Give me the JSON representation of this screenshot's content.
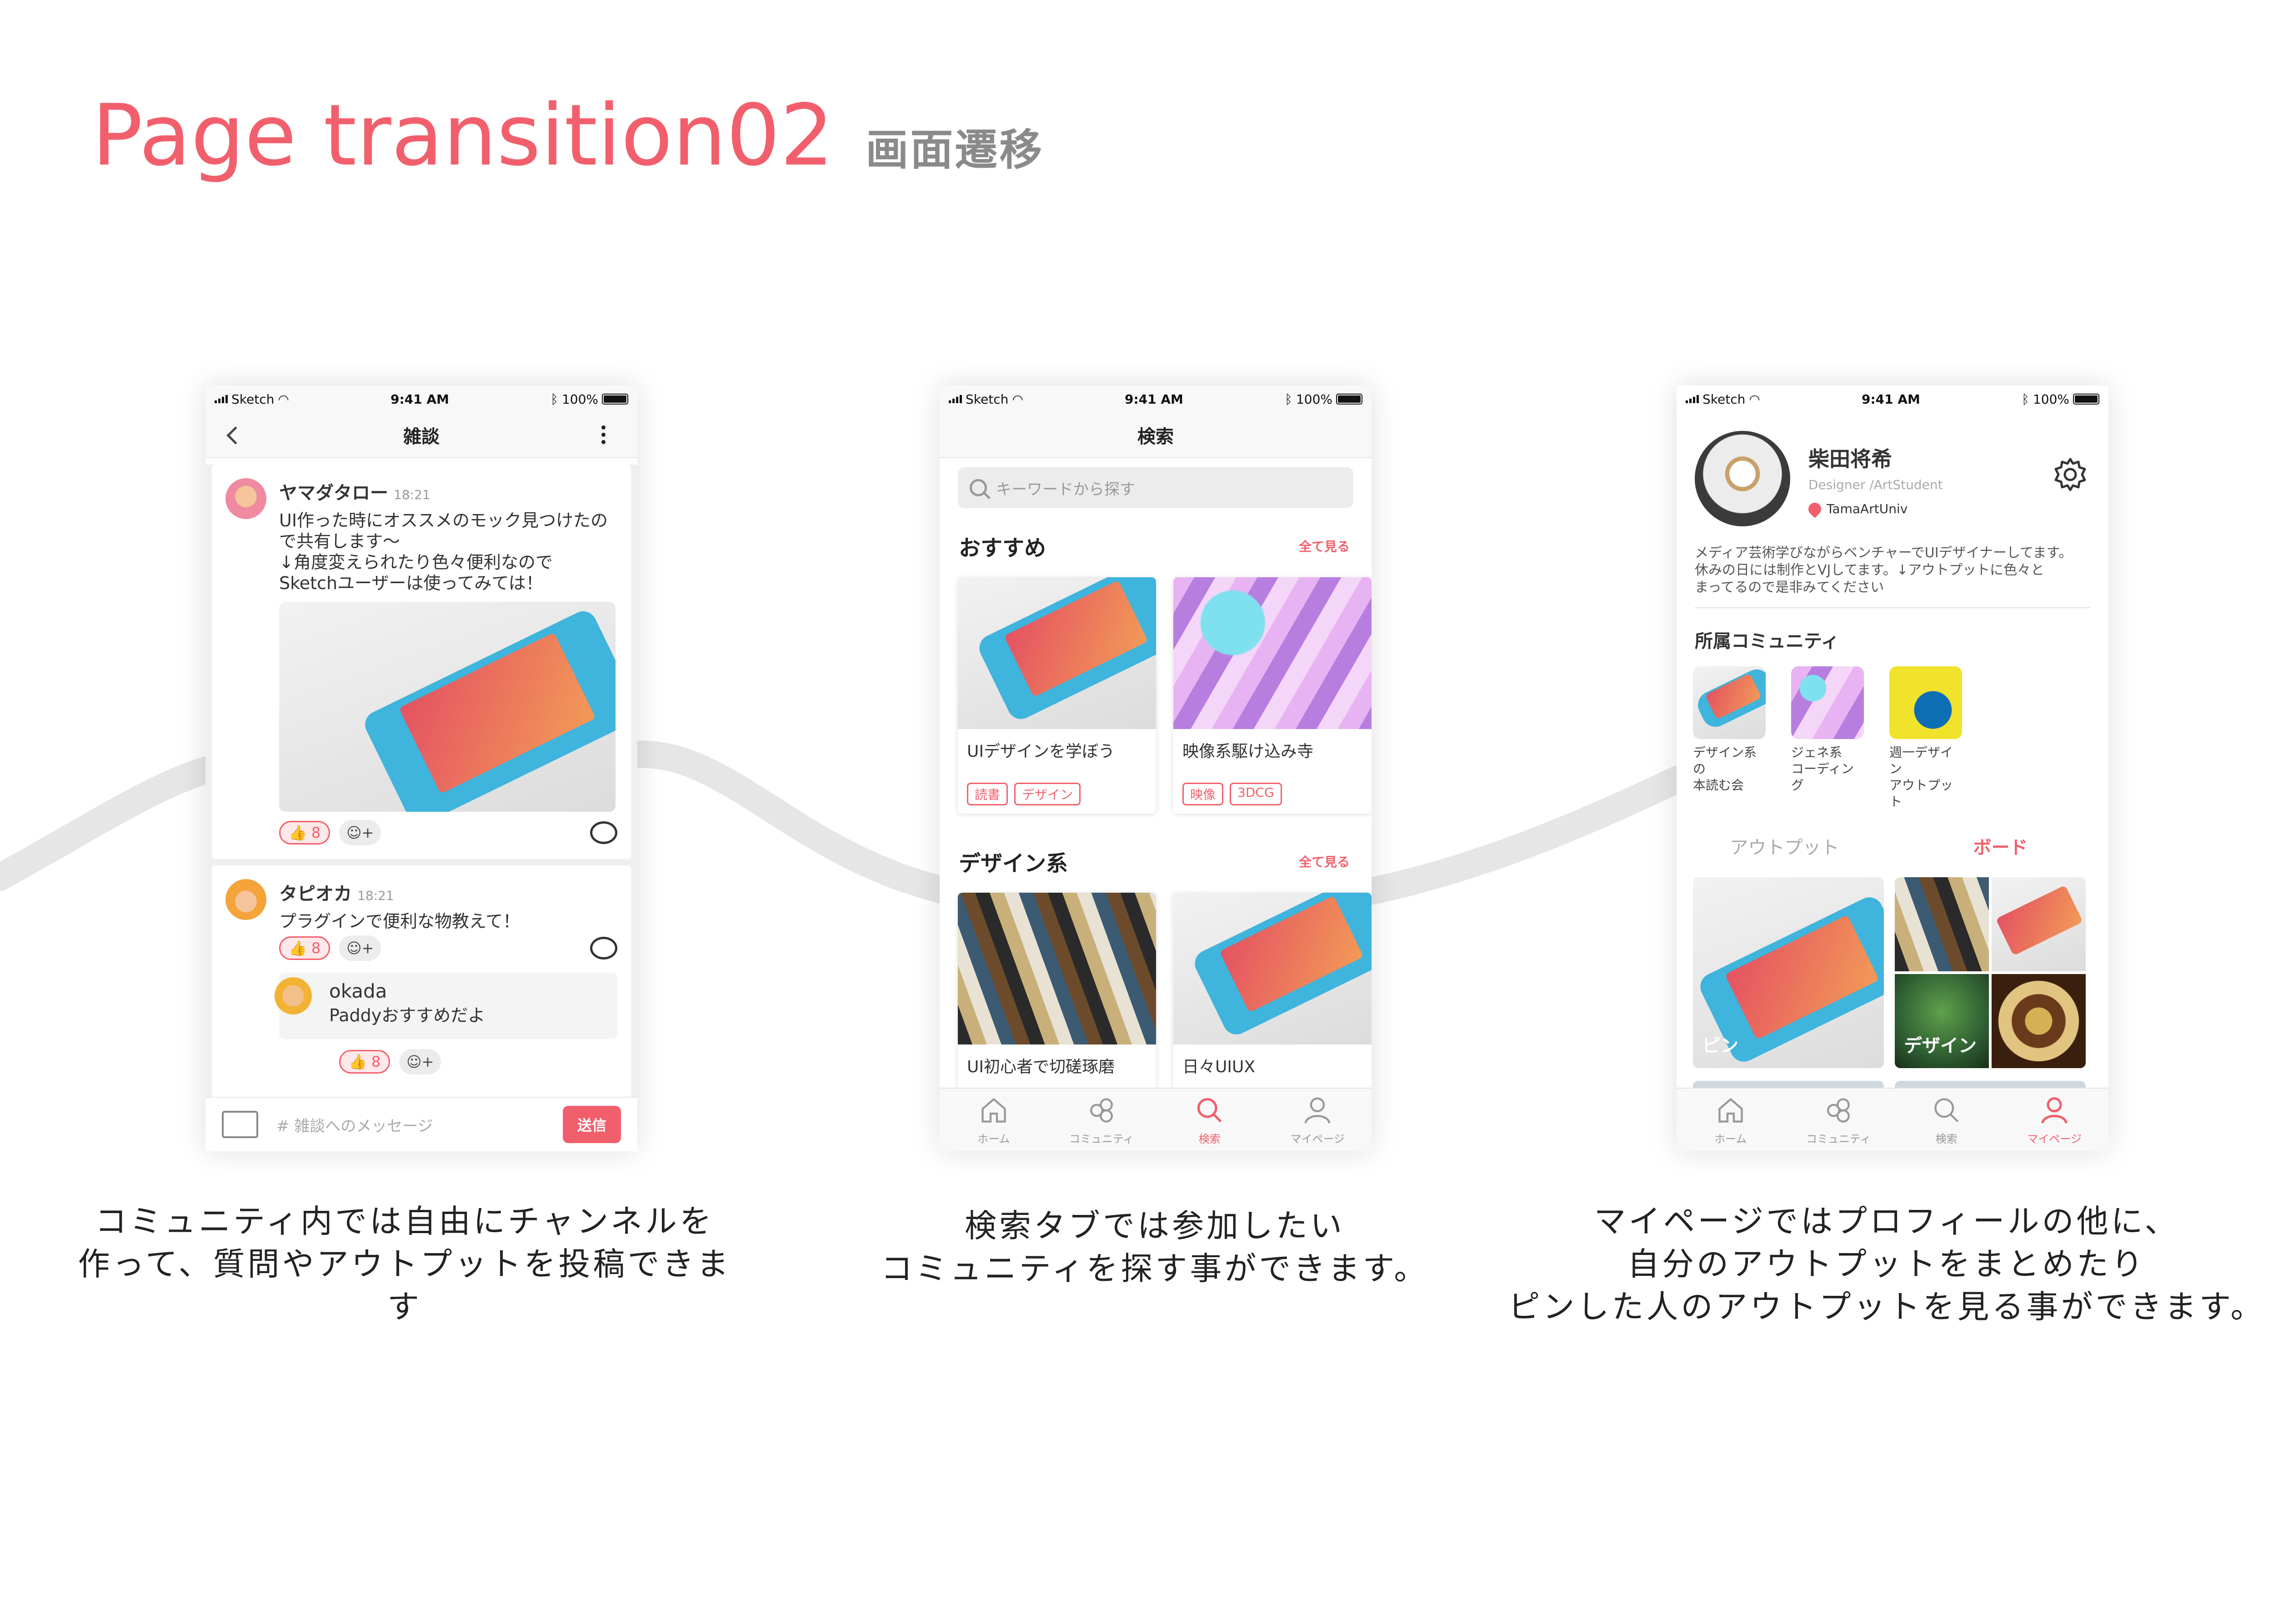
{
  "page": {
    "title_en": "Page transition02",
    "title_ja": "画面遷移"
  },
  "colors": {
    "accent": "#f25f6c",
    "text": "#333333",
    "muted": "#999999"
  },
  "status_bar": {
    "carrier": "Sketch",
    "time": "9:41 AM",
    "battery": "100%"
  },
  "chat_screen": {
    "nav_title": "雑談",
    "posts": [
      {
        "name": "ヤマダタロー",
        "time": "18:21",
        "text": "UI作った時にオススメのモック見つけたので共有します〜\n↓角度変えられたり色々便利なので\nSketchユーザーは使ってみては！",
        "likes": "8"
      },
      {
        "name": "タピオカ",
        "time": "18:21",
        "text": "プラグインで便利な物教えて！",
        "likes": "8",
        "reply": {
          "name": "okada",
          "text": "Paddyおすすめだよ",
          "likes": "8"
        }
      }
    ],
    "message_placeholder": "# 雑談へのメッセージ",
    "send_label": "送信"
  },
  "search_screen": {
    "nav_title": "検索",
    "search_placeholder": "キーワードから探す",
    "sections": [
      {
        "title": "おすすめ",
        "see_all": "全て見る",
        "cards": [
          {
            "name": "UIデザインを学ぼう",
            "tags": [
              "読書",
              "デザイン"
            ]
          },
          {
            "name": "映像系駆け込み寺",
            "tags": [
              "映像",
              "3DCG"
            ]
          }
        ]
      },
      {
        "title": "デザイン系",
        "see_all": "全て見る",
        "cards": [
          {
            "name": "UI初心者で切磋琢磨"
          },
          {
            "name": "日々UIUX"
          }
        ]
      }
    ]
  },
  "profile_screen": {
    "name": "柴田将希",
    "role": "Designer /ArtStudent",
    "location": "TamaArtUniv",
    "bio": "メディア芸術学びながらベンチャーでUIデザイナーしてます。\n休みの日には制作とVJしてます。↓アウトプットに色々と\nまってるので是非みてください",
    "communities_title": "所属コミュニティ",
    "communities": [
      {
        "label": "デザイン系の\n本読む会"
      },
      {
        "label": "ジェネ系\nコーディング"
      },
      {
        "label": "週一デザイン\nアウトプット"
      }
    ],
    "segments": [
      "アウトプット",
      "ボード"
    ],
    "boards": [
      {
        "label": "ピン"
      },
      {
        "label": "デザイン"
      }
    ]
  },
  "tabbar": {
    "items": [
      {
        "label": "ホーム",
        "icon": "home-icon"
      },
      {
        "label": "コミュニティ",
        "icon": "community-icon"
      },
      {
        "label": "検索",
        "icon": "search-icon"
      },
      {
        "label": "マイページ",
        "icon": "user-icon"
      }
    ]
  },
  "captions": {
    "chat": "コミュニティ内では自由にチャンネルを\n作って、質問やアウトプットを投稿できます",
    "search": "検索タブでは参加したい\nコミュニティを探す事ができます。",
    "profile": "マイページではプロフィールの他に、\n自分のアウトプットをまとめたり\nピンした人のアウトプットを見る事ができます。"
  }
}
